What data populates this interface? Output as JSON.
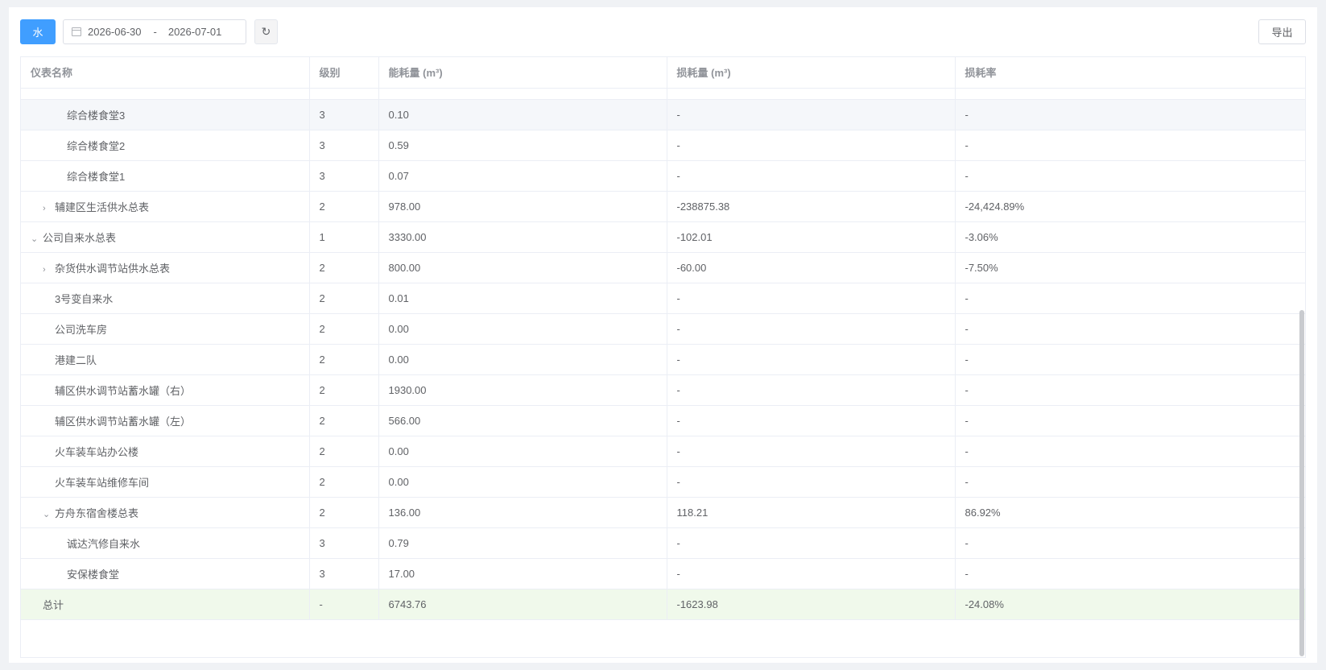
{
  "toolbar": {
    "water_button": "水",
    "date_start": "2026-06-30",
    "date_separator": "-",
    "date_end": "2026-07-01",
    "refresh_icon": "refresh-icon",
    "export_button": "导出"
  },
  "table": {
    "headers": [
      "仪表名称",
      "级别",
      "能耗量 (m³)",
      "损耗量 (m³)",
      "损耗率"
    ],
    "rows": [
      {
        "name": "综合楼食堂3",
        "level": "3",
        "consumption": "0.10",
        "loss": "-",
        "rate": "-"
      },
      {
        "name": "综合楼食堂2",
        "level": "3",
        "consumption": "0.59",
        "loss": "-",
        "rate": "-"
      },
      {
        "name": "综合楼食堂1",
        "level": "3",
        "consumption": "0.07",
        "loss": "-",
        "rate": "-"
      },
      {
        "name": "辅建区生活供水总表",
        "level": "2",
        "consumption": "978.00",
        "loss": "-238875.38",
        "rate": "-24,424.89%"
      },
      {
        "name": "公司自来水总表",
        "level": "1",
        "consumption": "3330.00",
        "loss": "-102.01",
        "rate": "-3.06%"
      },
      {
        "name": "杂货供水调节站供水总表",
        "level": "2",
        "consumption": "800.00",
        "loss": "-60.00",
        "rate": "-7.50%"
      },
      {
        "name": "3号变自来水",
        "level": "2",
        "consumption": "0.01",
        "loss": "-",
        "rate": "-"
      },
      {
        "name": "公司洗车房",
        "level": "2",
        "consumption": "0.00",
        "loss": "-",
        "rate": "-"
      },
      {
        "name": "港建二队",
        "level": "2",
        "consumption": "0.00",
        "loss": "-",
        "rate": "-"
      },
      {
        "name": "辅区供水调节站蓄水罐（右）",
        "level": "2",
        "consumption": "1930.00",
        "loss": "-",
        "rate": "-"
      },
      {
        "name": "辅区供水调节站蓄水罐（左）",
        "level": "2",
        "consumption": "566.00",
        "loss": "-",
        "rate": "-"
      },
      {
        "name": "火车装车站办公楼",
        "level": "2",
        "consumption": "0.00",
        "loss": "-",
        "rate": "-"
      },
      {
        "name": "火车装车站维修车间",
        "level": "2",
        "consumption": "0.00",
        "loss": "-",
        "rate": "-"
      },
      {
        "name": "方舟东宿舍楼总表",
        "level": "2",
        "consumption": "136.00",
        "loss": "118.21",
        "rate": "86.92%"
      },
      {
        "name": "诚达汽修自来水",
        "level": "3",
        "consumption": "0.79",
        "loss": "-",
        "rate": "-"
      },
      {
        "name": "安保楼食堂",
        "level": "3",
        "consumption": "17.00",
        "loss": "-",
        "rate": "-"
      }
    ],
    "total": {
      "name": "总计",
      "level": "-",
      "consumption": "6743.76",
      "loss": "-1623.98",
      "rate": "-24.08%"
    },
    "expand_collapsed_icon": "›",
    "expand_open_icon": "⌄"
  }
}
